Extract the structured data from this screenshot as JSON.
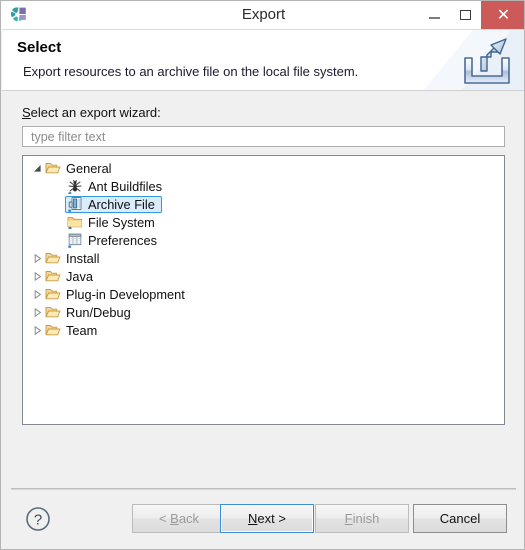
{
  "window": {
    "title": "Export",
    "app_icon": "eclipse-logo-icon",
    "controls": {
      "minimize": "minimize-icon",
      "maximize": "maximize-icon",
      "close": "close-icon",
      "close_color": "#cc5a58"
    }
  },
  "header": {
    "title": "Select",
    "description": "Export resources to an archive file on the local file system.",
    "banner_icon": "export-arrow-icon"
  },
  "form": {
    "label_mnemonic": "S",
    "label_rest": "elect an export wizard:",
    "filter": {
      "value": "",
      "placeholder": "type filter text"
    }
  },
  "tree": {
    "selected": "Archive File",
    "selection_fill": "#d8ecfb",
    "selection_border": "#3399dd",
    "nodes": [
      {
        "label": "General",
        "level": 0,
        "expanded": true,
        "icon": "open-folder-icon",
        "selected": false
      },
      {
        "label": "Ant Buildfiles",
        "level": 1,
        "expanded": null,
        "icon": "ant-icon",
        "selected": false
      },
      {
        "label": "Archive File",
        "level": 1,
        "expanded": null,
        "icon": "archive-file-icon",
        "selected": true
      },
      {
        "label": "File System",
        "level": 1,
        "expanded": null,
        "icon": "folder-icon",
        "selected": false
      },
      {
        "label": "Preferences",
        "level": 1,
        "expanded": null,
        "icon": "preferences-icon",
        "selected": false
      },
      {
        "label": "Install",
        "level": 0,
        "expanded": false,
        "icon": "open-folder-icon",
        "selected": false
      },
      {
        "label": "Java",
        "level": 0,
        "expanded": false,
        "icon": "open-folder-icon",
        "selected": false
      },
      {
        "label": "Plug-in Development",
        "level": 0,
        "expanded": false,
        "icon": "open-folder-icon",
        "selected": false
      },
      {
        "label": "Run/Debug",
        "level": 0,
        "expanded": false,
        "icon": "open-folder-icon",
        "selected": false
      },
      {
        "label": "Team",
        "level": 0,
        "expanded": false,
        "icon": "open-folder-icon",
        "selected": false
      }
    ]
  },
  "footer": {
    "help_icon": "help-question-icon",
    "buttons": [
      {
        "id": "back",
        "label": "< Back",
        "mnemonic": "B",
        "enabled": false,
        "default": false
      },
      {
        "id": "next",
        "label": "Next >",
        "mnemonic": "N",
        "enabled": true,
        "default": true
      },
      {
        "id": "finish",
        "label": "Finish",
        "mnemonic": "F",
        "enabled": false,
        "default": false
      },
      {
        "id": "cancel",
        "label": "Cancel",
        "mnemonic": "",
        "enabled": true,
        "default": false
      }
    ]
  }
}
